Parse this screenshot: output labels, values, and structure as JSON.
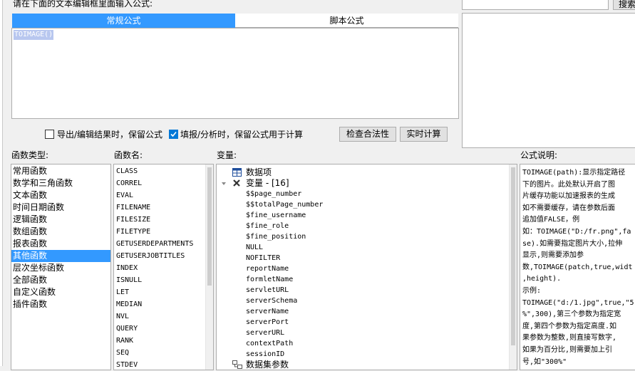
{
  "prompt": "请在下面的文本编辑框里面输入公式:",
  "tabs": [
    {
      "label": "常规公式",
      "active": true
    },
    {
      "label": "脚本公式",
      "active": false
    }
  ],
  "formula_text": "TOIMAGE()",
  "options": {
    "keep_on_export": {
      "label": "导出/编辑结果时，保留公式",
      "checked": false
    },
    "keep_on_fill": {
      "label": "填报/分析时，保留公式用于计算",
      "checked": true
    }
  },
  "buttons": {
    "check": "检查合法性",
    "realtime": "实时计算",
    "search": "搜索"
  },
  "panels": {
    "func_type_label": "函数类型:",
    "func_name_label": "函数名:",
    "vars_label": "变量:",
    "desc_label": "公式说明:"
  },
  "func_types": [
    "常用函数",
    "数学和三角函数",
    "文本函数",
    "时间日期函数",
    "逻辑函数",
    "数组函数",
    "报表函数",
    "其他函数",
    "层次坐标函数",
    "全部函数",
    "自定义函数",
    "插件函数"
  ],
  "func_types_selected": "其他函数",
  "func_names": [
    "CLASS",
    "CORREL",
    "EVAL",
    "FILENAME",
    "FILESIZE",
    "FILETYPE",
    "GETUSERDEPARTMENTS",
    "GETUSERJOBTITLES",
    "INDEX",
    "ISNULL",
    "LET",
    "MEDIAN",
    "NVL",
    "QUERY",
    "RANK",
    "SEQ",
    "STDEV"
  ],
  "variables": {
    "data_item": "数据项",
    "var_group": "变量 - [16]",
    "items": [
      "$$page_number",
      "$$totalPage_number",
      "$fine_username",
      "$fine_role",
      "$fine_position",
      "NULL",
      "NOFILTER",
      "reportName",
      "formletName",
      "servletURL",
      "serverSchema",
      "serverName",
      "serverPort",
      "serverURL",
      "contextPath",
      "sessionID"
    ],
    "dataset_params": "数据集参数"
  },
  "description_lines": [
    "TOIMAGE(path):显示指定路径",
    "下的图片。此处默认开启了图",
    "片缓存功能以加速报表的生成",
    "如不需要缓存，请在参数后面",
    "追加值FALSE，例",
    "如：TOIMAGE(\"D:/fr.png\",fa",
    "se).如需要指定图片大小,拉伸",
    "显示,则需要添加参",
    "数,TOIMAGE(patch,true,widt",
    ",height).",
    "示例:",
    "TOIMAGE(\"d:/1.jpg\",true,\"5",
    "%\",300),第三个参数为指定宽",
    "度,第四个参数为指定高度.如",
    "果参数为整数,则直接写数字,",
    "如果为百分比,则需要加上引",
    "号,如\"300%\""
  ]
}
